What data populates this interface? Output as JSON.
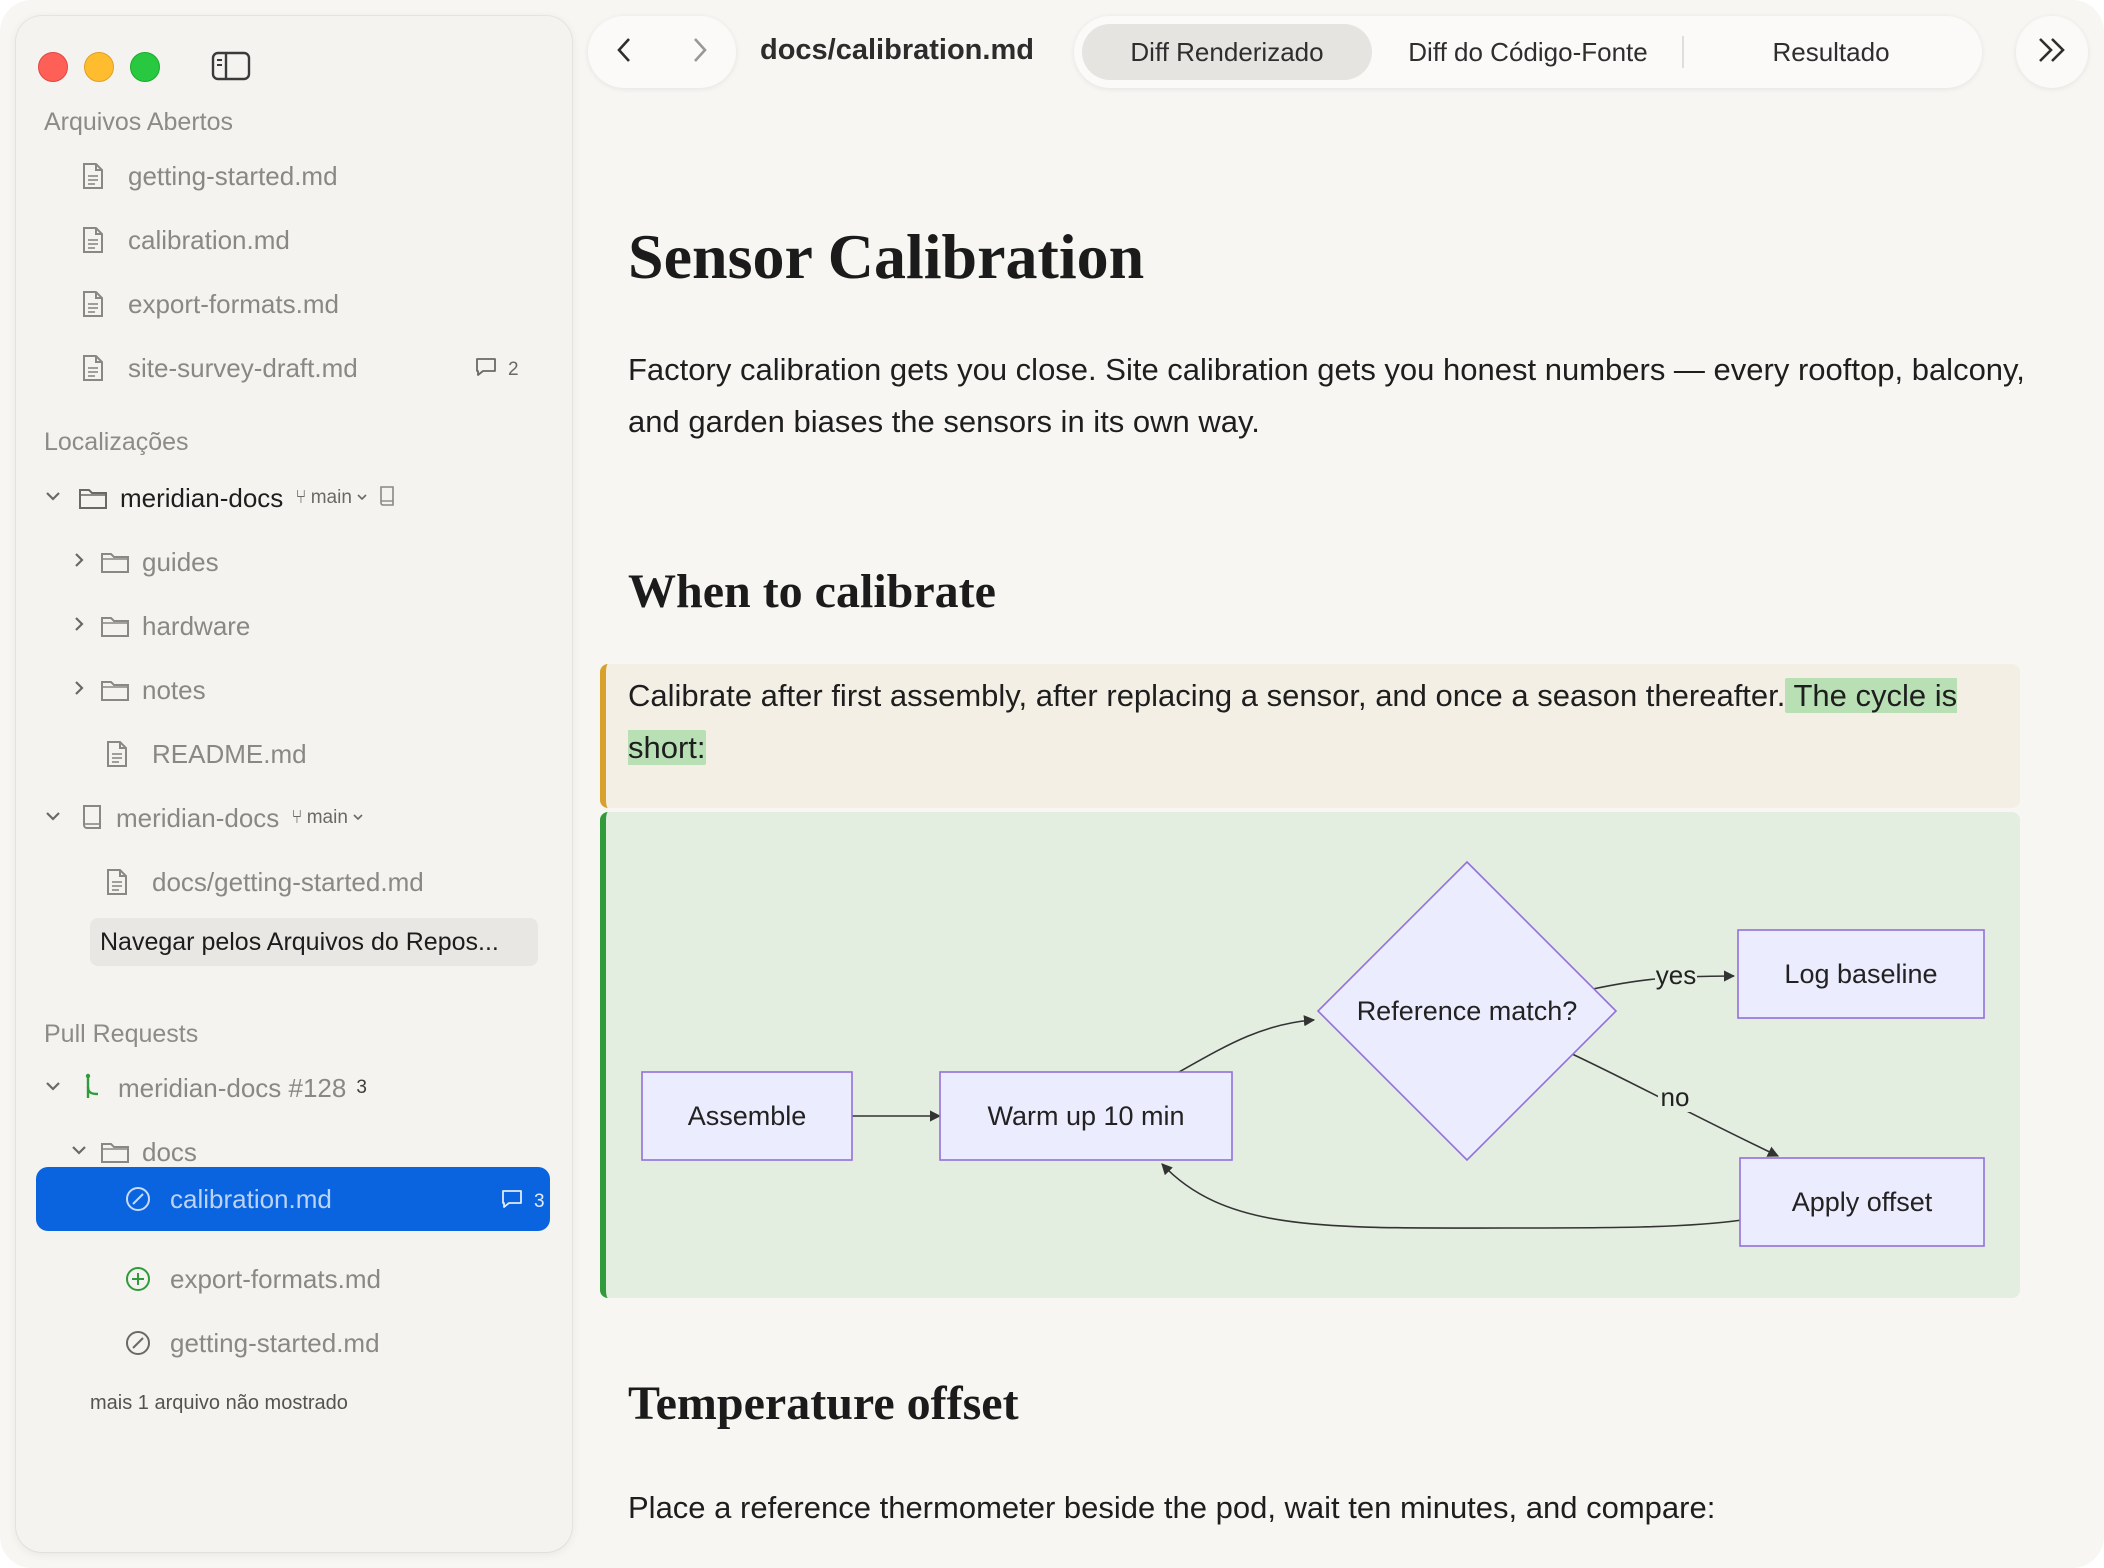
{
  "toolbar": {
    "doc_path": "docs/calibration.md",
    "tabs": [
      "Diff Renderizado",
      "Diff do Código-Fonte",
      "Resultado"
    ],
    "active_tab": "Diff Renderizado"
  },
  "sidebar": {
    "open_files_title": "Arquivos Abertos",
    "open_files": [
      {
        "label": "getting-started.md"
      },
      {
        "label": "calibration.md"
      },
      {
        "label": "export-formats.md"
      },
      {
        "label": "site-survey-draft.md",
        "comments": "2"
      }
    ],
    "locations_title": "Localizações",
    "repo1": {
      "name": "meridian-docs",
      "branch": "main"
    },
    "repo1_children": [
      "guides",
      "hardware",
      "notes",
      "README.md"
    ],
    "repo2": {
      "name": "meridian-docs",
      "branch": "main"
    },
    "repo2_file": "docs/getting-started.md",
    "browse_label": "Navegar pelos Arquivos do Repos...",
    "pull_requests_title": "Pull Requests",
    "pr": {
      "name": "meridian-docs #128",
      "count": "3"
    },
    "pr_folder": "docs",
    "pr_files": [
      {
        "label": "calibration.md",
        "status": "modified",
        "comments": "3",
        "selected": true
      },
      {
        "label": "export-formats.md",
        "status": "added"
      },
      {
        "label": "getting-started.md",
        "status": "modified"
      }
    ],
    "more_files": "mais 1 arquivo não mostrado"
  },
  "doc": {
    "title": "Sensor Calibration",
    "intro": "Factory calibration gets you close. Site calibration gets you honest numbers — every rooftop, balcony, and garden biases the sensors in its own way.",
    "h2_when": "When to calibrate",
    "when_text": "Calibrate after first assembly, after replacing a sensor, and once a season thereafter.",
    "when_added": " The cycle is short:",
    "h2_temp": "Temperature offset",
    "temp_text": "Place a reference thermometer beside the pod, wait ten minutes, and compare:"
  },
  "flowchart": {
    "nodes": {
      "assemble": "Assemble",
      "warmup": "Warm up 10 min",
      "reference": "Reference match?",
      "log": "Log baseline",
      "apply": "Apply offset"
    },
    "edge_yes": "yes",
    "edge_no": "no"
  },
  "colors": {
    "accent": "#0a64e0",
    "diff_changed_bar": "#d7a12c",
    "diff_added_bar": "#2f9b3a",
    "node_fill": "#ececff",
    "node_stroke": "#9370db"
  }
}
